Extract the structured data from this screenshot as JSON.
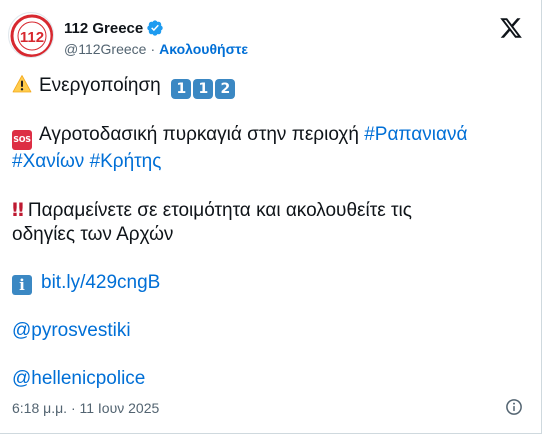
{
  "account": {
    "display_name": "112 Greece",
    "handle": "@112Greece",
    "separator": "·",
    "follow_label": "Ακολουθήστε",
    "avatar_text": "112",
    "verified": true
  },
  "post": {
    "line1_emoji": "warning-icon",
    "line1_text": "Ενεργοποίηση",
    "keycaps": [
      "1",
      "1",
      "2"
    ],
    "line2_badge": "SOS",
    "line2_text": "Αγροτοδασική πυρκαγιά στην περιοχή",
    "line2_tag1": "#Ραπανιανά",
    "line3_tag2": "#Χανίων",
    "line3_tag3": "#Κρήτης",
    "line4_emoji": "‼",
    "line4_text": "Παραμείνετε σε ετοιμότητα και ακολουθείτε τις",
    "line5_text": "οδηγίες των Αρχών",
    "line6_info": "i",
    "line6_link": "bit.ly/429cngB",
    "mention1": "@pyrosvestiki",
    "mention2": "@hellenicpolice"
  },
  "footer": {
    "timestamp": "6:18 μ.μ. · 11 Ιουν 2025"
  },
  "colors": {
    "link": "#006fd6",
    "text": "#0f1419",
    "muted": "#536471",
    "verified": "#1d9bf0",
    "avatar_red": "#d7282f"
  }
}
